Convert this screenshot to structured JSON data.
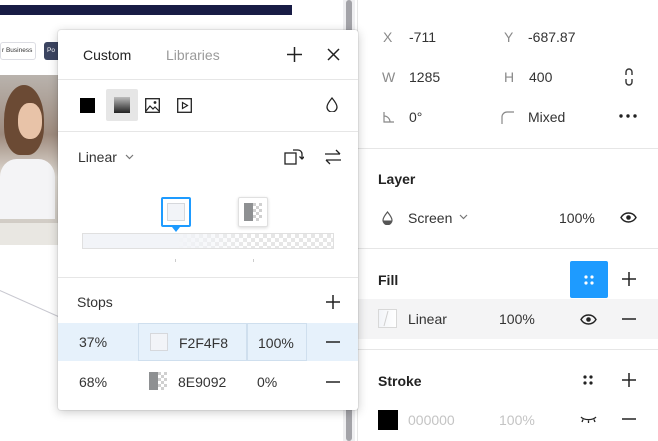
{
  "canvas": {
    "chip_text": "r Business",
    "chip2_text": "Po"
  },
  "popover": {
    "tabs": [
      {
        "label": "Custom",
        "active": true
      },
      {
        "label": "Libraries",
        "active": false
      }
    ],
    "fill_types": [
      "solid-fill-icon",
      "gradient-fill-icon",
      "image-fill-icon",
      "video-fill-icon"
    ],
    "gradient_type": "Linear",
    "stops_title": "Stops",
    "stops": [
      {
        "position": "37%",
        "hex": "F2F4F8",
        "opacity": "100%",
        "color": "#F2F4F8",
        "selected": true
      },
      {
        "position": "68%",
        "hex": "8E9092",
        "opacity": "0%",
        "color": "#8E9092",
        "selected": false
      }
    ]
  },
  "panel": {
    "x_label": "X",
    "x_value": "-711",
    "y_label": "Y",
    "y_value": "-687.87",
    "w_label": "W",
    "w_value": "1285",
    "h_label": "H",
    "h_value": "400",
    "rotation_value": "0°",
    "radius_value": "Mixed",
    "layer_title": "Layer",
    "blend_mode": "Screen",
    "layer_opacity": "100%",
    "fill_title": "Fill",
    "fill_type": "Linear",
    "fill_opacity": "100%",
    "stroke_title": "Stroke",
    "stroke_hex": "000000",
    "stroke_opacity": "100%",
    "accent_color": "#1E9BFF"
  }
}
